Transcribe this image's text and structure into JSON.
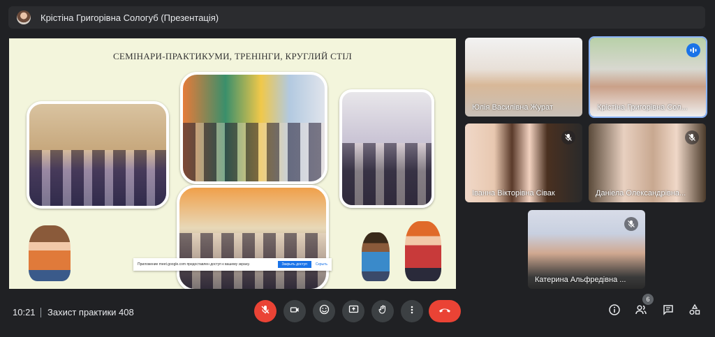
{
  "header": {
    "presenter_label": "Крістіна Григорівна Сологуб (Презентація)"
  },
  "slide": {
    "title": "СЕМІНАРИ-ПРАКТИКУМИ, ТРЕНІНГИ, КРУГЛИЙ СТІЛ",
    "share_notice": {
      "text": "Приложение meet.google.com предоставлен доступ к вашему экрану.",
      "stop_label": "Закрыть доступ",
      "hide_label": "Скрыть"
    }
  },
  "participants": [
    {
      "name": "Юлія Василівна Журат",
      "muted": false
    },
    {
      "name": "Крістіна Григорівна Сол...",
      "speaking": true
    },
    {
      "name": "Іванна Вікторівна Сівак",
      "muted": true
    },
    {
      "name": "Даніела Олександрівна...",
      "muted": true
    },
    {
      "name": "Катерина Альфредівна ...",
      "muted": true
    }
  ],
  "footer": {
    "time": "10:21",
    "meeting_name": "Захист практики 408",
    "participant_count": "6"
  },
  "colors": {
    "end_call": "#ea4335",
    "mic_off": "#ea4335",
    "speaking": "#1a73e8",
    "background": "#202124"
  }
}
